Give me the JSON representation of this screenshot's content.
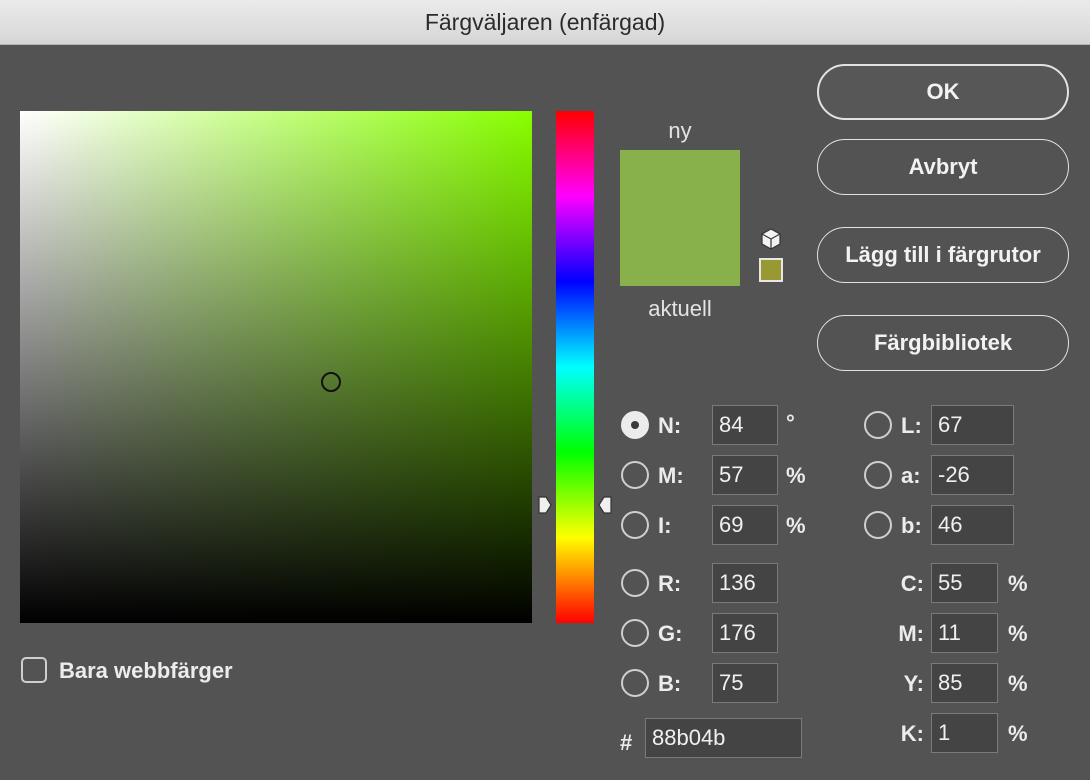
{
  "window": {
    "title": "Färgväljaren (enfärgad)"
  },
  "colors": {
    "new": "#88b04b",
    "current": "#88b04b",
    "web_safe": "#999933",
    "hue_base": "#88ff00"
  },
  "preview": {
    "new_label": "ny",
    "current_label": "aktuell"
  },
  "buttons": {
    "ok": "OK",
    "cancel": "Avbryt",
    "add_to_swatches": "Lägg till i färgrutor",
    "color_libraries": "Färgbibliotek"
  },
  "hsb": {
    "h": {
      "label": "N:",
      "value": "84",
      "unit": "°",
      "selected": true
    },
    "s": {
      "label": "M:",
      "value": "57",
      "unit": "%"
    },
    "b": {
      "label": "I:",
      "value": "69",
      "unit": "%"
    }
  },
  "rgb": {
    "r": {
      "label": "R:",
      "value": "136"
    },
    "g": {
      "label": "G:",
      "value": "176"
    },
    "b": {
      "label": "B:",
      "value": "75"
    }
  },
  "hex": {
    "label": "#",
    "value": "88b04b"
  },
  "lab": {
    "l": {
      "label": "L:",
      "value": "67"
    },
    "a": {
      "label": "a:",
      "value": "-26"
    },
    "b": {
      "label": "b:",
      "value": "46"
    }
  },
  "cmyk": {
    "c": {
      "label": "C:",
      "value": "55",
      "unit": "%"
    },
    "m": {
      "label": "M:",
      "value": "11",
      "unit": "%"
    },
    "y": {
      "label": "Y:",
      "value": "85",
      "unit": "%"
    },
    "k": {
      "label": "K:",
      "value": "1",
      "unit": "%"
    }
  },
  "web_only": {
    "label": "Bara webbfärger",
    "checked": false
  }
}
